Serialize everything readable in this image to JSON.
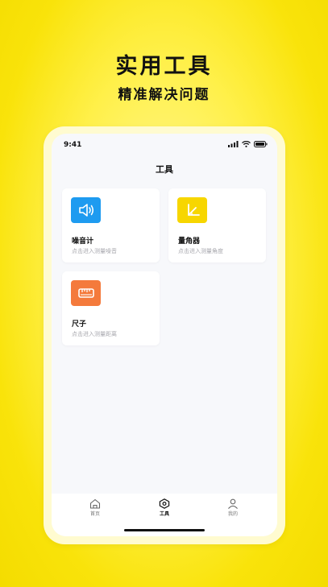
{
  "promo": {
    "title": "实用工具",
    "subtitle": "精准解决问题"
  },
  "status_bar": {
    "time": "9:41"
  },
  "nav": {
    "title": "工具"
  },
  "tools": [
    {
      "name": "噪音计",
      "desc": "点击进入测量噪音",
      "icon": "speaker-icon",
      "color": "#1e9bf0"
    },
    {
      "name": "量角器",
      "desc": "点击进入测量角度",
      "icon": "protractor-icon",
      "color": "#f7d600"
    },
    {
      "name": "尺子",
      "desc": "点击进入测量距离",
      "icon": "ruler-icon",
      "color": "#f47a3c"
    }
  ],
  "tabbar": {
    "items": [
      {
        "label": "首页",
        "icon": "home-icon"
      },
      {
        "label": "工具",
        "icon": "tools-icon"
      },
      {
        "label": "我的",
        "icon": "profile-icon"
      }
    ],
    "active_index": 1
  }
}
